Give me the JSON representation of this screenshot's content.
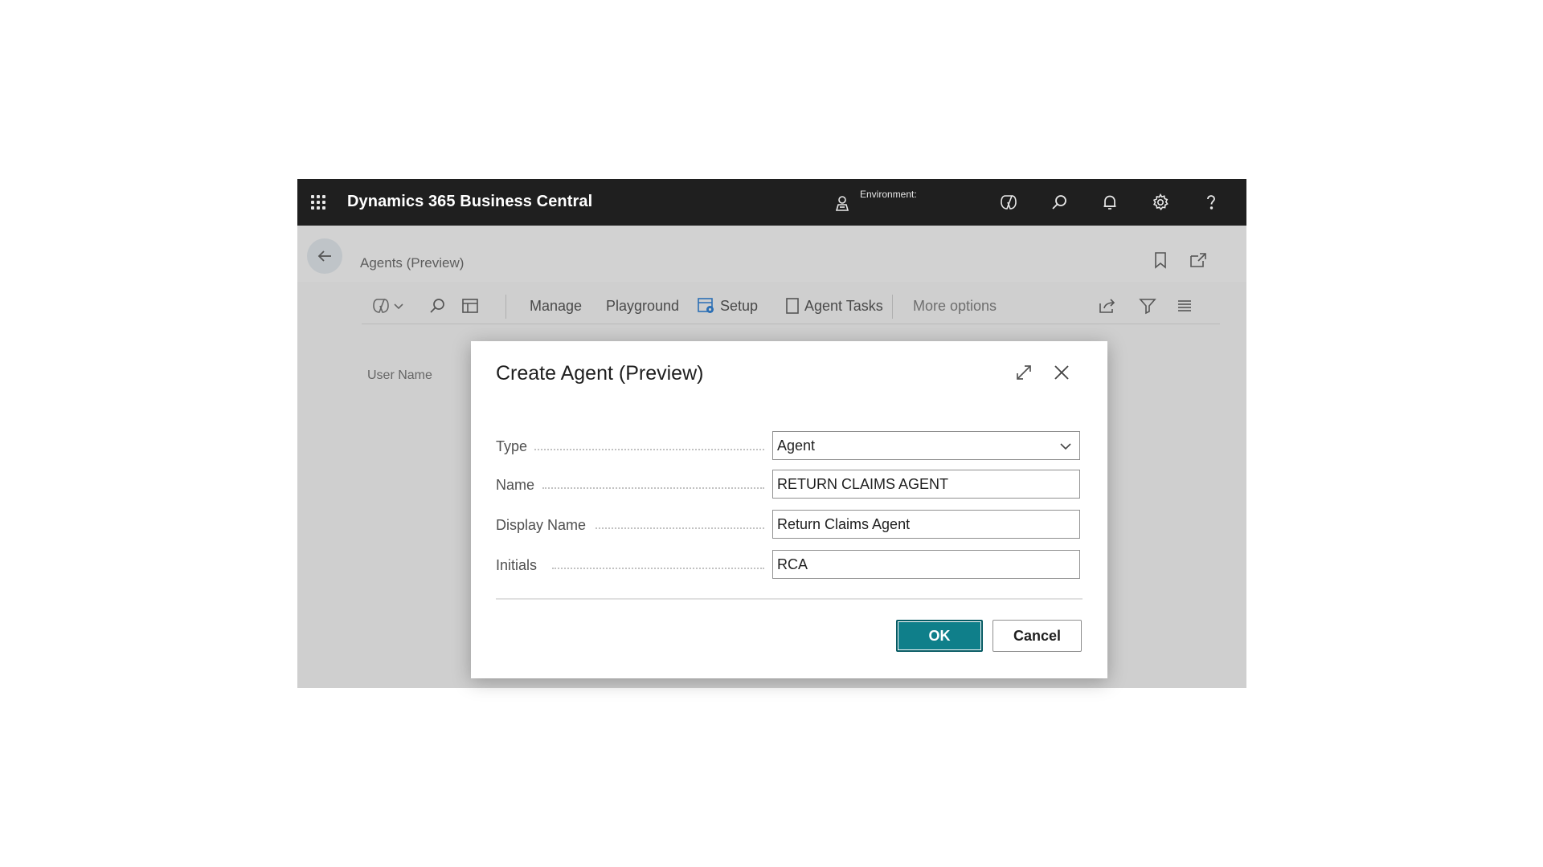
{
  "topbar": {
    "app_title": "Dynamics 365 Business Central",
    "environment_label": "Environment:",
    "icons": [
      "waffle-icon",
      "environment-icon",
      "copilot-icon",
      "search-icon",
      "bell-icon",
      "gear-icon",
      "help-icon"
    ]
  },
  "page": {
    "title": "Agents (Preview)",
    "icons": [
      "back-arrow-icon",
      "bookmark-icon",
      "open-new-window-icon"
    ]
  },
  "toolbar": {
    "manage_label": "Manage",
    "playground_label": "Playground",
    "setup_label": "Setup",
    "agent_tasks_label": "Agent Tasks",
    "more_options_label": "More options",
    "icons": [
      "copilot-icon",
      "chevron-down-icon",
      "search-icon",
      "layout-icon",
      "setup-icon",
      "agent-tasks-icon",
      "share-icon",
      "filter-icon",
      "list-icon"
    ]
  },
  "list": {
    "column_user_name": "User Name"
  },
  "dialog": {
    "title": "Create Agent (Preview)",
    "fields": {
      "type": {
        "label": "Type",
        "value": "Agent"
      },
      "name": {
        "label": "Name",
        "value": "RETURN CLAIMS AGENT"
      },
      "display_name": {
        "label": "Display Name",
        "value": "Return Claims Agent"
      },
      "initials": {
        "label": "Initials",
        "value": "RCA"
      }
    },
    "ok_label": "OK",
    "cancel_label": "Cancel",
    "icons": [
      "expand-icon",
      "close-icon",
      "chevron-down-icon"
    ]
  },
  "colors": {
    "topbar_bg": "#1f1f1f",
    "overlay_bg": "#cfcfcf",
    "ok_button": "#0f7f8a"
  }
}
